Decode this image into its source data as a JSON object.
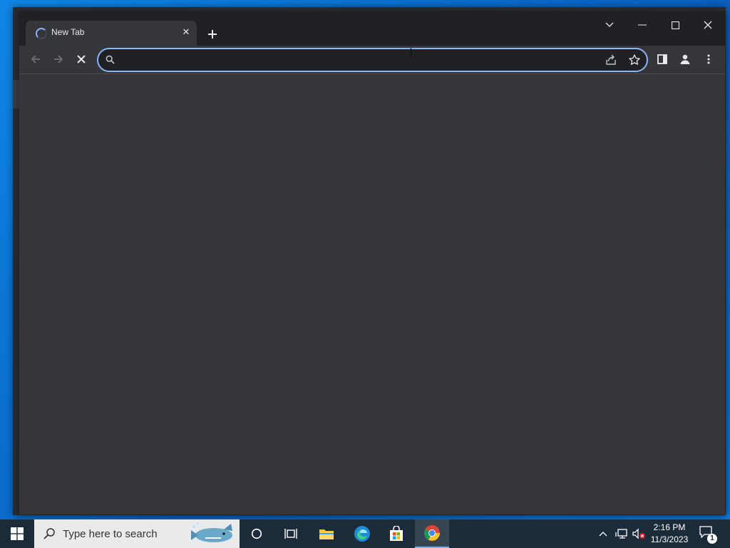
{
  "browser": {
    "tab": {
      "title": "New Tab",
      "loading": true
    },
    "omnibox": {
      "value": "",
      "placeholder": ""
    },
    "colors": {
      "frame": "#202124",
      "toolbar": "#35363a",
      "focus_ring": "#8ab4f8",
      "text": "#e8eaed"
    }
  },
  "taskbar": {
    "search_placeholder": "Type here to search",
    "clock": {
      "time": "2:16 PM",
      "date": "11/3/2023"
    },
    "notification_count": "1",
    "pinned": [
      "cortana-icon",
      "task-view-icon",
      "file-explorer-icon",
      "edge-icon",
      "store-icon",
      "chrome-icon"
    ]
  }
}
